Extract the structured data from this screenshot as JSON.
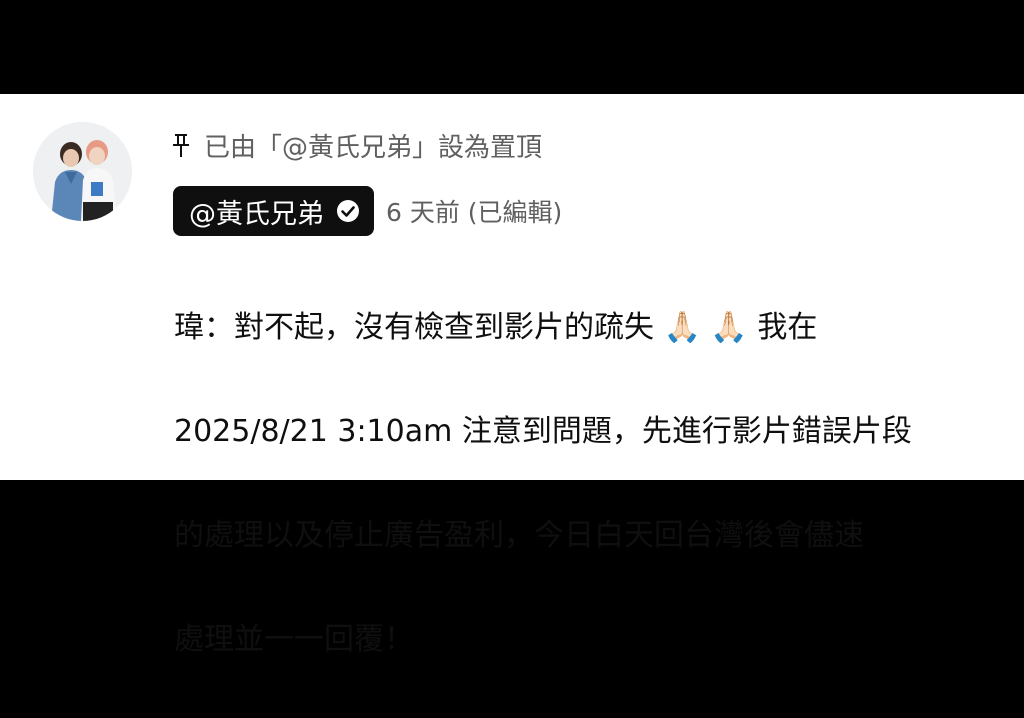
{
  "comment": {
    "pinned_text": "已由「@黃氏兄弟」設為置頂",
    "author": "@黃氏兄弟",
    "time": "6 天前 (已編輯)",
    "body_lines": [
      "瑋：對不起，沒有檢查到影片的疏失 🙏🏻 🙏🏻 我在",
      "2025/8/21 3:10am 注意到問題，先進行影片錯誤片段",
      "的處理以及停止廣告盈利，今日白天回台灣後會儘速",
      "處理並一一回覆！"
    ]
  },
  "icons": {
    "pin": "pin-icon",
    "verified": "verified-badge-icon",
    "avatar": "channel-avatar"
  },
  "colors": {
    "chip_background": "#0f0f0f",
    "secondary_text": "#606060",
    "primary_text": "#0f0f0f"
  }
}
